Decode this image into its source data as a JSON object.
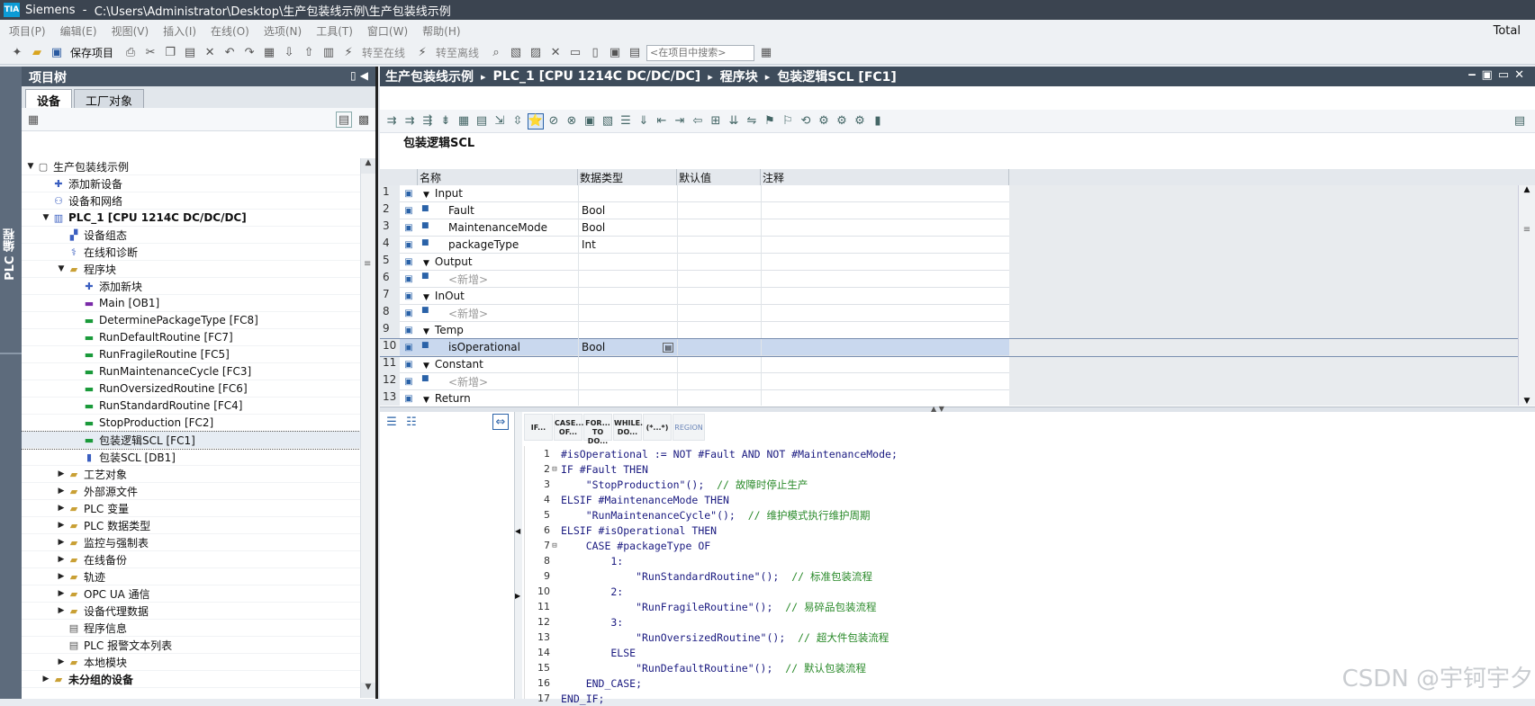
{
  "titlebar": {
    "app": "Siemens",
    "sep": "  -  ",
    "path": "C:\\Users\\Administrator\\Desktop\\生产包装线示例\\生产包装线示例"
  },
  "menu": [
    "项目(P)",
    "编辑(E)",
    "视图(V)",
    "插入(I)",
    "在线(O)",
    "选项(N)",
    "工具(T)",
    "窗口(W)",
    "帮助(H)"
  ],
  "menu_right": "Total",
  "toolbar": {
    "save_label": "保存项目",
    "go_online": "转至在线",
    "go_offline": "转至离线",
    "search_placeholder": "<在项目中搜索>"
  },
  "side_label": "PLC 编程",
  "tree": {
    "title": "项目树",
    "tabs": [
      "设备",
      "工厂对象"
    ],
    "items": [
      {
        "label": "生产包装线示例",
        "exp": "▼",
        "icon": "project-icon"
      },
      {
        "label": "添加新设备",
        "exp": "",
        "icon": "add-device-icon"
      },
      {
        "label": "设备和网络",
        "exp": "",
        "icon": "network-icon"
      },
      {
        "label": "PLC_1 [CPU 1214C DC/DC/DC]",
        "exp": "▼",
        "icon": "plc-icon"
      },
      {
        "label": "设备组态",
        "exp": "",
        "icon": "device-config-icon"
      },
      {
        "label": "在线和诊断",
        "exp": "",
        "icon": "diagnostics-icon"
      },
      {
        "label": "程序块",
        "exp": "▼",
        "icon": "folder-icon"
      },
      {
        "label": "添加新块",
        "exp": "",
        "icon": "add-block-icon"
      },
      {
        "label": "Main [OB1]",
        "exp": "",
        "icon": "ob-icon"
      },
      {
        "label": "DeterminePackageType [FC8]",
        "exp": "",
        "icon": "fc-icon"
      },
      {
        "label": "RunDefaultRoutine [FC7]",
        "exp": "",
        "icon": "fc-icon"
      },
      {
        "label": "RunFragileRoutine [FC5]",
        "exp": "",
        "icon": "fc-icon"
      },
      {
        "label": "RunMaintenanceCycle [FC3]",
        "exp": "",
        "icon": "fc-icon"
      },
      {
        "label": "RunOversizedRoutine [FC6]",
        "exp": "",
        "icon": "fc-icon"
      },
      {
        "label": "RunStandardRoutine [FC4]",
        "exp": "",
        "icon": "fc-icon"
      },
      {
        "label": "StopProduction [FC2]",
        "exp": "",
        "icon": "fc-icon"
      },
      {
        "label": "包装逻辑SCL [FC1]",
        "exp": "",
        "icon": "fc-icon"
      },
      {
        "label": "包装SCL [DB1]",
        "exp": "",
        "icon": "db-icon"
      },
      {
        "label": "工艺对象",
        "exp": "▶",
        "icon": "folder-icon"
      },
      {
        "label": "外部源文件",
        "exp": "▶",
        "icon": "folder-icon"
      },
      {
        "label": "PLC 变量",
        "exp": "▶",
        "icon": "folder-icon"
      },
      {
        "label": "PLC 数据类型",
        "exp": "▶",
        "icon": "folder-icon"
      },
      {
        "label": "监控与强制表",
        "exp": "▶",
        "icon": "folder-icon"
      },
      {
        "label": "在线备份",
        "exp": "▶",
        "icon": "folder-icon"
      },
      {
        "label": "轨迹",
        "exp": "▶",
        "icon": "folder-icon"
      },
      {
        "label": "OPC UA 通信",
        "exp": "▶",
        "icon": "folder-icon"
      },
      {
        "label": "设备代理数据",
        "exp": "▶",
        "icon": "folder-icon"
      },
      {
        "label": "程序信息",
        "exp": "",
        "icon": "info-icon"
      },
      {
        "label": "PLC 报警文本列表",
        "exp": "",
        "icon": "text-list-icon"
      },
      {
        "label": "本地模块",
        "exp": "▶",
        "icon": "folder-icon"
      },
      {
        "label": "未分组的设备",
        "exp": "▶",
        "icon": "folder-icon"
      }
    ]
  },
  "editor": {
    "breadcrumb": [
      "生产包装线示例",
      "PLC_1 [CPU 1214C DC/DC/DC]",
      "程序块",
      "包装逻辑SCL [FC1]"
    ],
    "block_title": "包装逻辑SCL",
    "columns": [
      "名称",
      "数据类型",
      "默认值",
      "注释"
    ],
    "rows": [
      {
        "n": "1",
        "name": "Input",
        "type": "",
        "group": true
      },
      {
        "n": "2",
        "name": "Fault",
        "type": "Bool",
        "group": false
      },
      {
        "n": "3",
        "name": "MaintenanceMode",
        "type": "Bool",
        "group": false
      },
      {
        "n": "4",
        "name": "packageType",
        "type": "Int",
        "group": false
      },
      {
        "n": "5",
        "name": "Output",
        "type": "",
        "group": true
      },
      {
        "n": "6",
        "name": "<新增>",
        "type": "",
        "group": false
      },
      {
        "n": "7",
        "name": "InOut",
        "type": "",
        "group": true
      },
      {
        "n": "8",
        "name": "<新增>",
        "type": "",
        "group": false
      },
      {
        "n": "9",
        "name": "Temp",
        "type": "",
        "group": true
      },
      {
        "n": "10",
        "name": "isOperational",
        "type": "Bool",
        "group": false
      },
      {
        "n": "11",
        "name": "Constant",
        "type": "",
        "group": true
      },
      {
        "n": "12",
        "name": "<新增>",
        "type": "",
        "group": false
      },
      {
        "n": "13",
        "name": "Return",
        "type": "",
        "group": true
      }
    ],
    "keywords": [
      "IF...",
      "CASE... OF...",
      "FOR... TO DO...",
      "WHILE... DO...",
      "(*...*)",
      "REGION"
    ],
    "code": [
      {
        "n": "1",
        "fold": "",
        "text": "#isOperational := NOT #Fault AND NOT #MaintenanceMode;"
      },
      {
        "n": "2",
        "fold": "⊟",
        "text": "IF #Fault THEN"
      },
      {
        "n": "3",
        "fold": "",
        "text": "    \"StopProduction\"();  // 故障时停止生产"
      },
      {
        "n": "4",
        "fold": "",
        "text": "ELSIF #MaintenanceMode THEN"
      },
      {
        "n": "5",
        "fold": "",
        "text": "    \"RunMaintenanceCycle\"();  // 维护模式执行维护周期"
      },
      {
        "n": "6",
        "fold": "",
        "text": "ELSIF #isOperational THEN"
      },
      {
        "n": "7",
        "fold": "⊟",
        "text": "    CASE #packageType OF"
      },
      {
        "n": "8",
        "fold": "",
        "text": "        1:"
      },
      {
        "n": "9",
        "fold": "",
        "text": "            \"RunStandardRoutine\"();  // 标准包装流程"
      },
      {
        "n": "10",
        "fold": "",
        "text": "        2:"
      },
      {
        "n": "11",
        "fold": "",
        "text": "            \"RunFragileRoutine\"();  // 易碎品包装流程"
      },
      {
        "n": "12",
        "fold": "",
        "text": "        3:"
      },
      {
        "n": "13",
        "fold": "",
        "text": "            \"RunOversizedRoutine\"();  // 超大件包装流程"
      },
      {
        "n": "14",
        "fold": "",
        "text": "        ELSE"
      },
      {
        "n": "15",
        "fold": "",
        "text": "            \"RunDefaultRoutine\"();  // 默认包装流程"
      },
      {
        "n": "16",
        "fold": "",
        "text": "    END_CASE;"
      },
      {
        "n": "17",
        "fold": "",
        "text": "END_IF;"
      }
    ]
  },
  "watermark": "CSDN @宇钶宇夕"
}
